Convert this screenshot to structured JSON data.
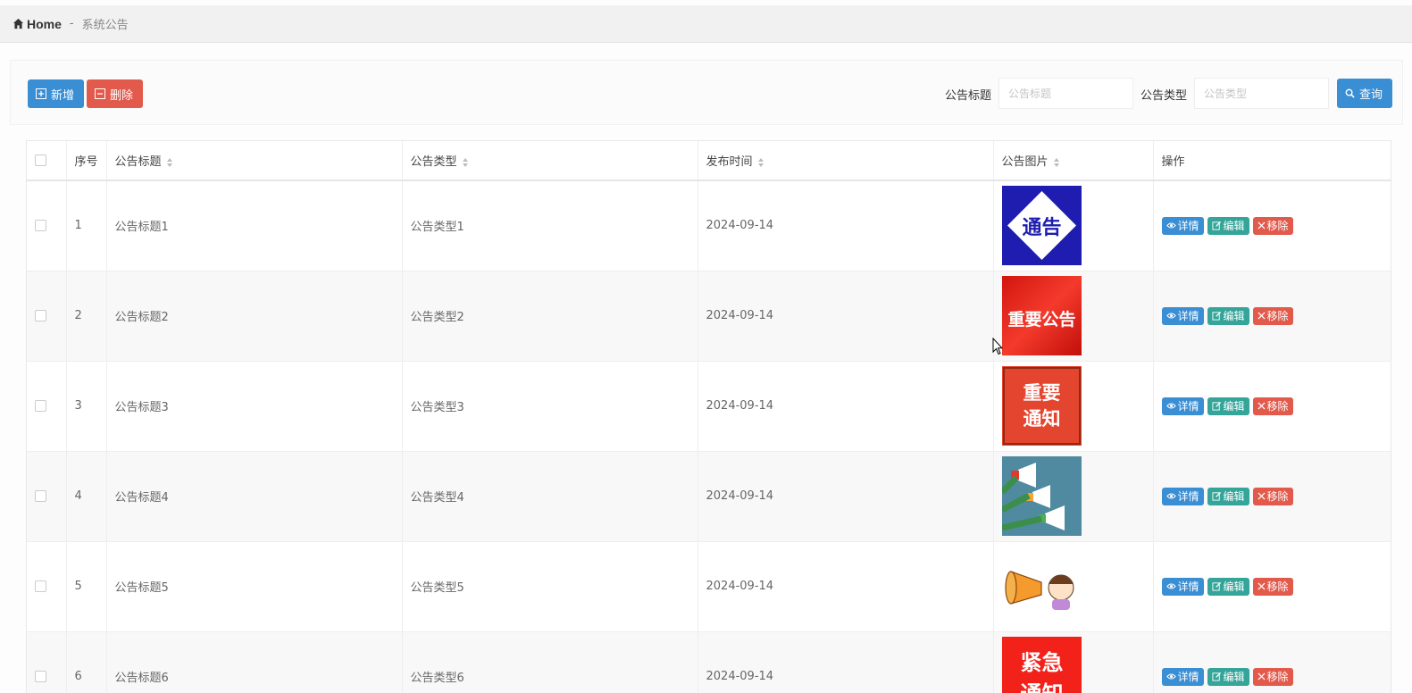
{
  "breadcrumb": {
    "home": "Home",
    "separator": "-",
    "current": "系统公告"
  },
  "toolbar": {
    "add_label": "新增",
    "delete_label": "删除",
    "search_label": "查询",
    "filters": [
      {
        "label": "公告标题",
        "placeholder": "公告标题"
      },
      {
        "label": "公告类型",
        "placeholder": "公告类型"
      }
    ]
  },
  "table": {
    "headers": [
      "序号",
      "公告标题",
      "公告类型",
      "发布时间",
      "公告图片",
      "操作"
    ],
    "actions": {
      "view": "详情",
      "edit": "编辑",
      "remove": "移除"
    },
    "rows": [
      {
        "index": "1",
        "title": "公告标题1",
        "type": "公告类型1",
        "date": "2024-09-14",
        "image_text": "通告",
        "image_kind": "diamond"
      },
      {
        "index": "2",
        "title": "公告标题2",
        "type": "公告类型2",
        "date": "2024-09-14",
        "image_text": "重要公告",
        "image_kind": "red-banner"
      },
      {
        "index": "3",
        "title": "公告标题3",
        "type": "公告类型3",
        "date": "2024-09-14",
        "image_text": "重要通知",
        "image_kind": "red-framed"
      },
      {
        "index": "4",
        "title": "公告标题4",
        "type": "公告类型4",
        "date": "2024-09-14",
        "image_text": "",
        "image_kind": "megaphones"
      },
      {
        "index": "5",
        "title": "公告标题5",
        "type": "公告类型5",
        "date": "2024-09-14",
        "image_text": "",
        "image_kind": "girl-megaphone"
      },
      {
        "index": "6",
        "title": "公告标题6",
        "type": "公告类型6",
        "date": "2024-09-14",
        "image_text": "紧急通知",
        "image_kind": "urgent"
      }
    ]
  },
  "colors": {
    "primary": "#3a8ed4",
    "danger": "#e25a4b",
    "success": "#35a59a"
  }
}
